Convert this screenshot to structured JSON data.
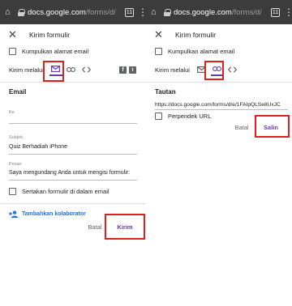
{
  "browser": {
    "url_host": "docs.google.com",
    "url_path": "/forms/d/",
    "tab_count": "11"
  },
  "dialog": {
    "title": "Kirim formulir",
    "collect_email_label": "Kumpulkan alamat email",
    "send_via_label": "Kirim melalui"
  },
  "email_tab": {
    "section_title": "Email",
    "to_label": "Ke",
    "to_value": "",
    "subject_label": "Subjek",
    "subject_value": "Quiz Berhadiah iPhone",
    "message_label": "Pesan",
    "message_value": "Saya mengundang Anda untuk mengisi formulir:",
    "include_form_label": "Sertakan formulir di dalam email",
    "add_collaborators": "Tambahkan kolaborator",
    "cancel_label": "Batal",
    "send_label": "Kirim"
  },
  "link_tab": {
    "section_title": "Tautan",
    "link_value": "https://docs.google.com/forms/d/e/1FAIpQLSe8UxJC",
    "shorten_label": "Perpendek URL",
    "cancel_label": "Batal",
    "copy_label": "Salin"
  },
  "icons": [
    "home-icon",
    "lock-icon",
    "tabs-icon",
    "more-vert-icon",
    "close-icon",
    "email-icon",
    "link-icon",
    "embed-icon",
    "facebook-icon",
    "twitter-icon",
    "add-person-icon"
  ],
  "colors": {
    "accent": "#673ab7",
    "highlight": "#e0201b",
    "link": "#1a73e8",
    "browser_bar": "#3c3c3c"
  }
}
